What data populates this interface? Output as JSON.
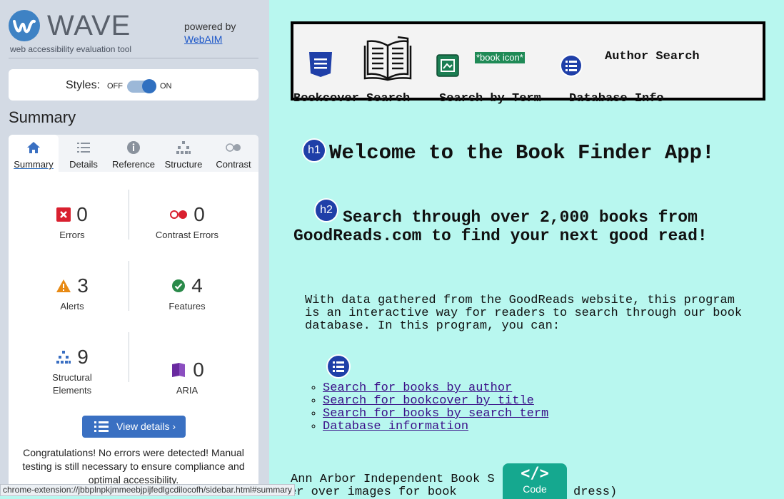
{
  "wave": {
    "logo_text": "WAVE",
    "tagline": "web accessibility evaluation tool",
    "powered_by": "powered by",
    "powered_link": "WebAIM",
    "styles_label": "Styles:",
    "toggle_off": "OFF",
    "toggle_on": "ON",
    "toggle_state": "on",
    "summary_title": "Summary",
    "tabs": [
      {
        "label": "Summary",
        "icon": "home-icon",
        "active": true
      },
      {
        "label": "Details",
        "icon": "list-icon",
        "active": false
      },
      {
        "label": "Reference",
        "icon": "info-icon",
        "active": false
      },
      {
        "label": "Structure",
        "icon": "structure-icon",
        "active": false
      },
      {
        "label": "Contrast",
        "icon": "contrast-icon",
        "active": false
      }
    ],
    "stats": {
      "errors": {
        "value": "0",
        "label": "Errors",
        "color": "#d9202f"
      },
      "contrast_errors": {
        "value": "0",
        "label": "Contrast Errors",
        "color": "#d9202f"
      },
      "alerts": {
        "value": "3",
        "label": "Alerts",
        "color": "#e88a14"
      },
      "features": {
        "value": "4",
        "label": "Features",
        "color": "#2a8a4a"
      },
      "structural": {
        "value": "9",
        "label": "Structural Elements",
        "color": "#3a6fc2"
      },
      "aria": {
        "value": "0",
        "label": "ARIA",
        "color": "#6a2aa0"
      }
    },
    "view_details": "View details ›",
    "congrats": "Congratulations! No errors were detected! Manual testing is still necessary to ensure compliance and optimal accessibility."
  },
  "page": {
    "nav": {
      "author_search": "Author Search",
      "bookcover_search": "Bookcover Search",
      "search_by_term": "Search by Term",
      "database_info": "Database Info",
      "book_icon_alt": "*book icon*"
    },
    "h1_badge": "h1",
    "h2_badge": "h2",
    "h1": "Welcome to the Book Finder App!",
    "h2": "Search through over 2,000 books from GoodReads.com to find your next good read!",
    "intro": "With data gathered from the GoodReads website, this program is an interactive way for readers to search through our book database. In this program, you can:",
    "links": [
      "Search for books by author",
      "Search for bookcover by title",
      "Search for books by search term",
      "Database information"
    ],
    "footer_line1": "Ann Arbor Independent Book S",
    "footer_line2": "er over images for book",
    "footer_line2_tail": "dress)"
  },
  "code_tab": {
    "label": "Code",
    "icon": "code-icon"
  },
  "status_url": "chrome-extension://jbbplnpkjmmeebjpijfedlgcdilocofh/sidebar.html#summary",
  "colors": {
    "sidebar_bg": "#d3dae4",
    "page_bg": "#b8f7ef",
    "accent": "#3a70c2",
    "link": "#3a0f88"
  }
}
